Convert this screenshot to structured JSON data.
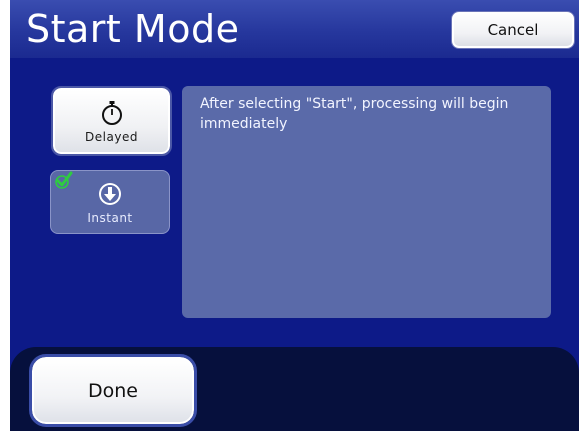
{
  "header": {
    "title": "Start Mode",
    "cancel_label": "Cancel"
  },
  "modes": [
    {
      "label": "Delayed",
      "icon": "stopwatch-icon",
      "selected": false
    },
    {
      "label": "Instant",
      "icon": "arrow-down-circle-icon",
      "selected": true
    }
  ],
  "description": "After selecting \"Start\", processing will begin immediately",
  "footer": {
    "done_label": "Done"
  },
  "colors": {
    "background": "#0d1a88",
    "panel": "#5a6aa9",
    "check": "#2ecc40"
  }
}
